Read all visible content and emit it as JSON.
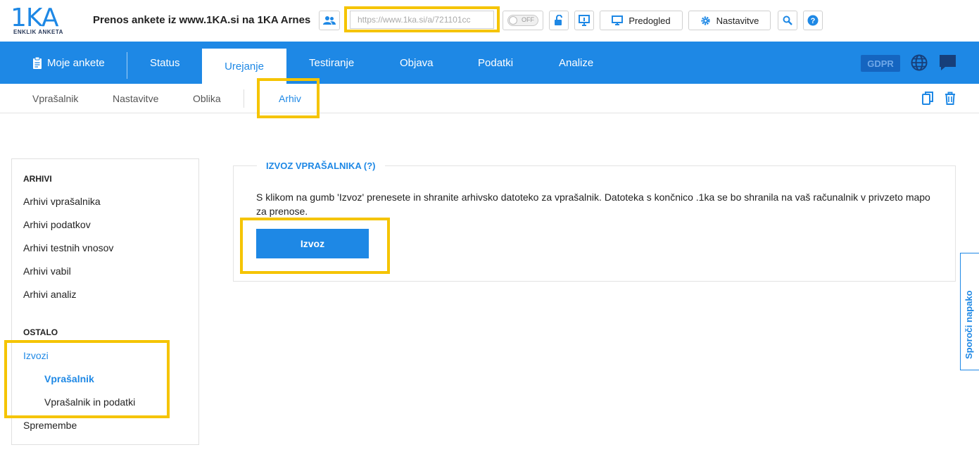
{
  "app": {
    "logo_text": "1KA",
    "logo_subtitle": "ENKLIK ANKETA",
    "survey_title": "Prenos ankete iz www.1KA.si na 1KA Arnes"
  },
  "toolbar": {
    "url": "https://www.1ka.si/a/721101cc",
    "toggle_label": "OFF",
    "preview_label": "Predogled",
    "settings_label": "Nastavitve"
  },
  "nav": {
    "items": [
      {
        "label": "Moje ankete"
      },
      {
        "label": "Status"
      },
      {
        "label": "Urejanje"
      },
      {
        "label": "Testiranje"
      },
      {
        "label": "Objava"
      },
      {
        "label": "Podatki"
      },
      {
        "label": "Analize"
      }
    ],
    "active": "Urejanje",
    "gdpr_label": "GDPR"
  },
  "subnav": {
    "items": [
      {
        "label": "Vprašalnik"
      },
      {
        "label": "Nastavitve"
      },
      {
        "label": "Oblika"
      },
      {
        "label": "Arhiv"
      }
    ],
    "active": "Arhiv"
  },
  "sidebar": {
    "section1_title": "ARHIVI",
    "section1_items": [
      {
        "label": "Arhivi vprašalnika"
      },
      {
        "label": "Arhivi podatkov"
      },
      {
        "label": "Arhivi testnih vnosov"
      },
      {
        "label": "Arhivi vabil"
      },
      {
        "label": "Arhivi analiz"
      }
    ],
    "section2_title": "OSTALO",
    "exports_label": "Izvozi",
    "exports_sub": [
      {
        "label": "Vprašalnik"
      },
      {
        "label": "Vprašalnik in podatki"
      }
    ],
    "changes_label": "Spremembe"
  },
  "panel": {
    "title": "IZVOZ VPRAŠALNIKA (?)",
    "description": "S klikom na gumb 'Izvoz' prenesete in shranite arhivsko datoteko za vprašalnik. Datoteka s končnico .1ka se bo shranila na vaš računalnik v privzeto mapo za prenose.",
    "export_button": "Izvoz"
  },
  "report_tab": "Sporoči napako",
  "colors": {
    "primary": "#1e88e5",
    "highlight": "#f5c400",
    "gdpr_bg": "#1565c0"
  }
}
